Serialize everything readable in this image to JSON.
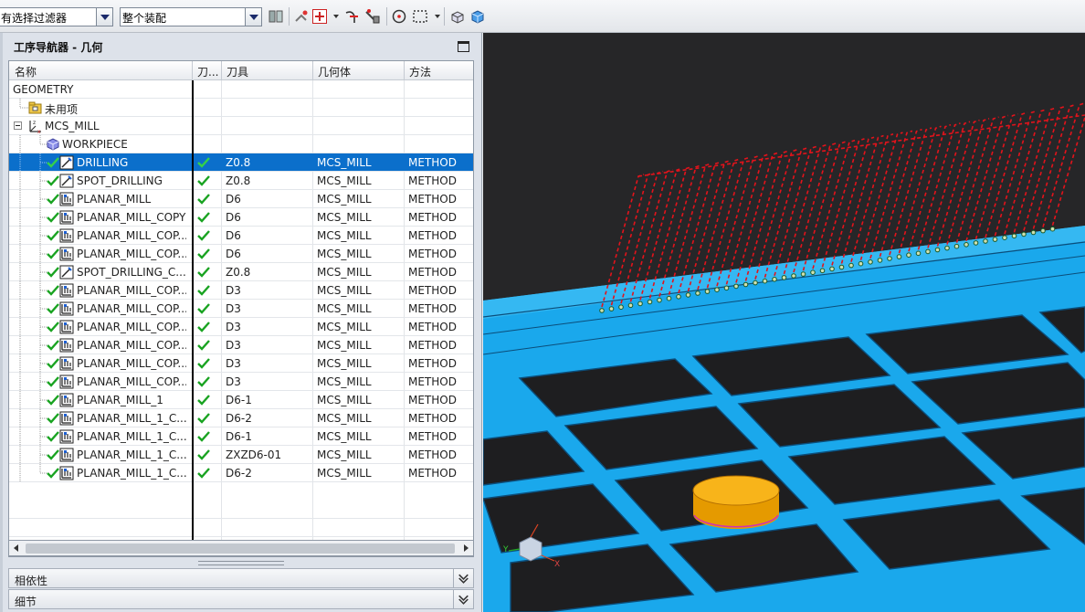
{
  "toolbar": {
    "filter_combo_value": "有选择过滤器",
    "assembly_combo_value": "整个装配",
    "icons": [
      "selection-filter-icon",
      "snap-point-icon",
      "select-point-icon",
      "trim-curve-icon",
      "dynamic-icon",
      "circle-select-icon",
      "rectangle-select-icon",
      "view-box-icon",
      "view-cube-icon"
    ]
  },
  "navigator": {
    "title": "工序导航器 - 几何",
    "columns": [
      "名称",
      "刀...",
      "刀具",
      "几何体",
      "方法"
    ],
    "tree": [
      {
        "name": "GEOMETRY",
        "level": 0,
        "type": "root"
      },
      {
        "name": "未用项",
        "level": 1,
        "type": "folder"
      },
      {
        "name": "MCS_MILL",
        "level": 1,
        "type": "mcs"
      },
      {
        "name": "WORKPIECE",
        "level": 2,
        "type": "workpiece"
      }
    ],
    "operations": [
      {
        "name": "DRILLING",
        "icon": "spot",
        "status": "ok",
        "tool": "Z0.8",
        "geometry": "MCS_MILL",
        "method": "METHOD",
        "selected": true
      },
      {
        "name": "SPOT_DRILLING",
        "icon": "spot",
        "status": "ok",
        "tool": "Z0.8",
        "geometry": "MCS_MILL",
        "method": "METHOD"
      },
      {
        "name": "PLANAR_MILL",
        "icon": "planar",
        "status": "ok",
        "tool": "D6",
        "geometry": "MCS_MILL",
        "method": "METHOD"
      },
      {
        "name": "PLANAR_MILL_COPY",
        "icon": "planar",
        "status": "ok",
        "tool": "D6",
        "geometry": "MCS_MILL",
        "method": "METHOD"
      },
      {
        "name": "PLANAR_MILL_COP...",
        "icon": "planar",
        "status": "ok",
        "tool": "D6",
        "geometry": "MCS_MILL",
        "method": "METHOD"
      },
      {
        "name": "PLANAR_MILL_COP...",
        "icon": "planar",
        "status": "ok",
        "tool": "D6",
        "geometry": "MCS_MILL",
        "method": "METHOD"
      },
      {
        "name": "SPOT_DRILLING_C...",
        "icon": "spot",
        "status": "ok",
        "tool": "Z0.8",
        "geometry": "MCS_MILL",
        "method": "METHOD"
      },
      {
        "name": "PLANAR_MILL_COP...",
        "icon": "planar",
        "status": "ok",
        "tool": "D3",
        "geometry": "MCS_MILL",
        "method": "METHOD"
      },
      {
        "name": "PLANAR_MILL_COP...",
        "icon": "planar",
        "status": "ok",
        "tool": "D3",
        "geometry": "MCS_MILL",
        "method": "METHOD"
      },
      {
        "name": "PLANAR_MILL_COP...",
        "icon": "planar",
        "status": "ok",
        "tool": "D3",
        "geometry": "MCS_MILL",
        "method": "METHOD"
      },
      {
        "name": "PLANAR_MILL_COP...",
        "icon": "planar",
        "status": "ok",
        "tool": "D3",
        "geometry": "MCS_MILL",
        "method": "METHOD"
      },
      {
        "name": "PLANAR_MILL_COP...",
        "icon": "planar",
        "status": "ok",
        "tool": "D3",
        "geometry": "MCS_MILL",
        "method": "METHOD"
      },
      {
        "name": "PLANAR_MILL_COP...",
        "icon": "planar",
        "status": "ok",
        "tool": "D3",
        "geometry": "MCS_MILL",
        "method": "METHOD"
      },
      {
        "name": "PLANAR_MILL_1",
        "icon": "planar",
        "status": "ok",
        "tool": "D6-1",
        "geometry": "MCS_MILL",
        "method": "METHOD"
      },
      {
        "name": "PLANAR_MILL_1_C...",
        "icon": "planar",
        "status": "ok",
        "tool": "D6-2",
        "geometry": "MCS_MILL",
        "method": "METHOD"
      },
      {
        "name": "PLANAR_MILL_1_C...",
        "icon": "planar",
        "status": "ok",
        "tool": "D6-1",
        "geometry": "MCS_MILL",
        "method": "METHOD"
      },
      {
        "name": "PLANAR_MILL_1_C...",
        "icon": "planar",
        "status": "ok",
        "tool": "ZXZD6-01",
        "geometry": "MCS_MILL",
        "method": "METHOD"
      },
      {
        "name": "PLANAR_MILL_1_C...",
        "icon": "planar",
        "status": "ok",
        "tool": "D6-2",
        "geometry": "MCS_MILL",
        "method": "METHOD"
      }
    ],
    "sections": [
      "相依性",
      "细节"
    ]
  },
  "viewport": {
    "triad_labels": [
      "Y",
      "X"
    ],
    "colors": {
      "background": "#262628",
      "part": "#19a9ee",
      "toolpath": "#e3131b",
      "tool": "#f5a800"
    }
  }
}
